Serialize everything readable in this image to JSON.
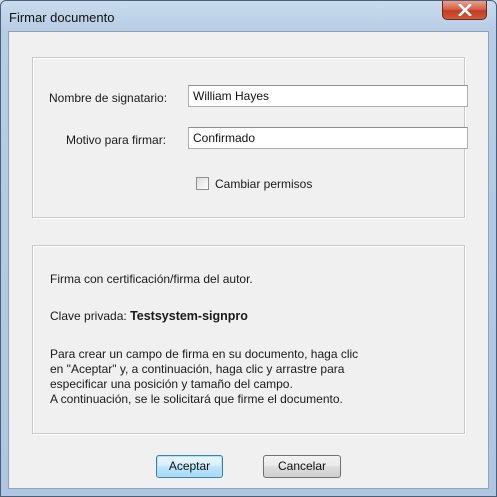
{
  "window": {
    "title": "Firmar documento"
  },
  "form": {
    "signer_label": "Nombre de signatario:",
    "signer_value": "William Hayes",
    "reason_label": "Motivo para firmar:",
    "reason_value": "Confirmado",
    "change_permissions_label": "Cambiar permisos",
    "change_permissions_checked": false
  },
  "info": {
    "certification_text": "Firma con certificación/firma del autor.",
    "private_key_label": "Clave privada:",
    "private_key_value": "Testsystem-signpro",
    "instructions": [
      "Para crear un campo de firma en su documento, haga clic",
      "en \"Aceptar\" y, a continuación, haga clic y arrastre para",
      "especificar una posición y tamaño del campo.",
      "A continuación, se le solicitará que firme el documento."
    ]
  },
  "buttons": {
    "accept_label": "Aceptar",
    "cancel_label": "Cancelar"
  },
  "icons": {
    "close": "close-icon"
  },
  "colors": {
    "close_button": "#c23c22",
    "default_button_border": "#3c7fb1",
    "dialog_background": "#f0f0f0"
  }
}
